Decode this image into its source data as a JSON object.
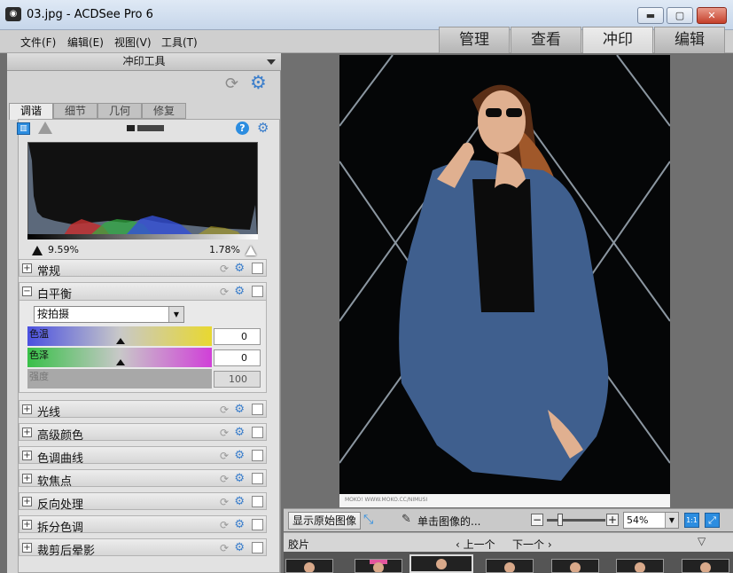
{
  "window": {
    "title": "03.jpg - ACDSee Pro 6",
    "min": "▬",
    "max": "▢",
    "close": "✕"
  },
  "menu": [
    "文件(F)",
    "编辑(E)",
    "视图(V)",
    "工具(T)"
  ],
  "modes": [
    "管理",
    "查看",
    "冲印",
    "编辑"
  ],
  "active_mode": "冲印",
  "panel": {
    "title": "冲印工具",
    "tabs": [
      "调谐",
      "细节",
      "几何",
      "修复"
    ],
    "active_tab": "调谐",
    "clip_left": "9.59%",
    "clip_right": "1.78%",
    "sections_top": [
      {
        "label": "常规",
        "expanded": false
      }
    ],
    "white_balance": {
      "label": "白平衡",
      "preset": "按拍摄",
      "sliders": [
        {
          "label": "色温",
          "value": "0"
        },
        {
          "label": "色泽",
          "value": "0"
        },
        {
          "label": "强度",
          "value": "100"
        }
      ]
    },
    "sections_bottom": [
      "光线",
      "高级颜色",
      "色调曲线",
      "软焦点",
      "反向处理",
      "拆分色调",
      "裁剪后晕影"
    ]
  },
  "viewer": {
    "watermark": "MOKO! WWW.MOKO.CC/NIMUSI",
    "show_original": "显示原始图像",
    "click_hint": "单击图像的...",
    "zoom": "54%",
    "zoom_minus": "−",
    "zoom_plus": "+",
    "ratio_btn": "1:1"
  },
  "filmstrip": {
    "label": "胶片",
    "prev": "上一个",
    "next": "下一个"
  },
  "colors": {
    "accent_blue": "#3b7ecb",
    "close_red": "#c5402b",
    "histogram_bg": "#111111"
  }
}
